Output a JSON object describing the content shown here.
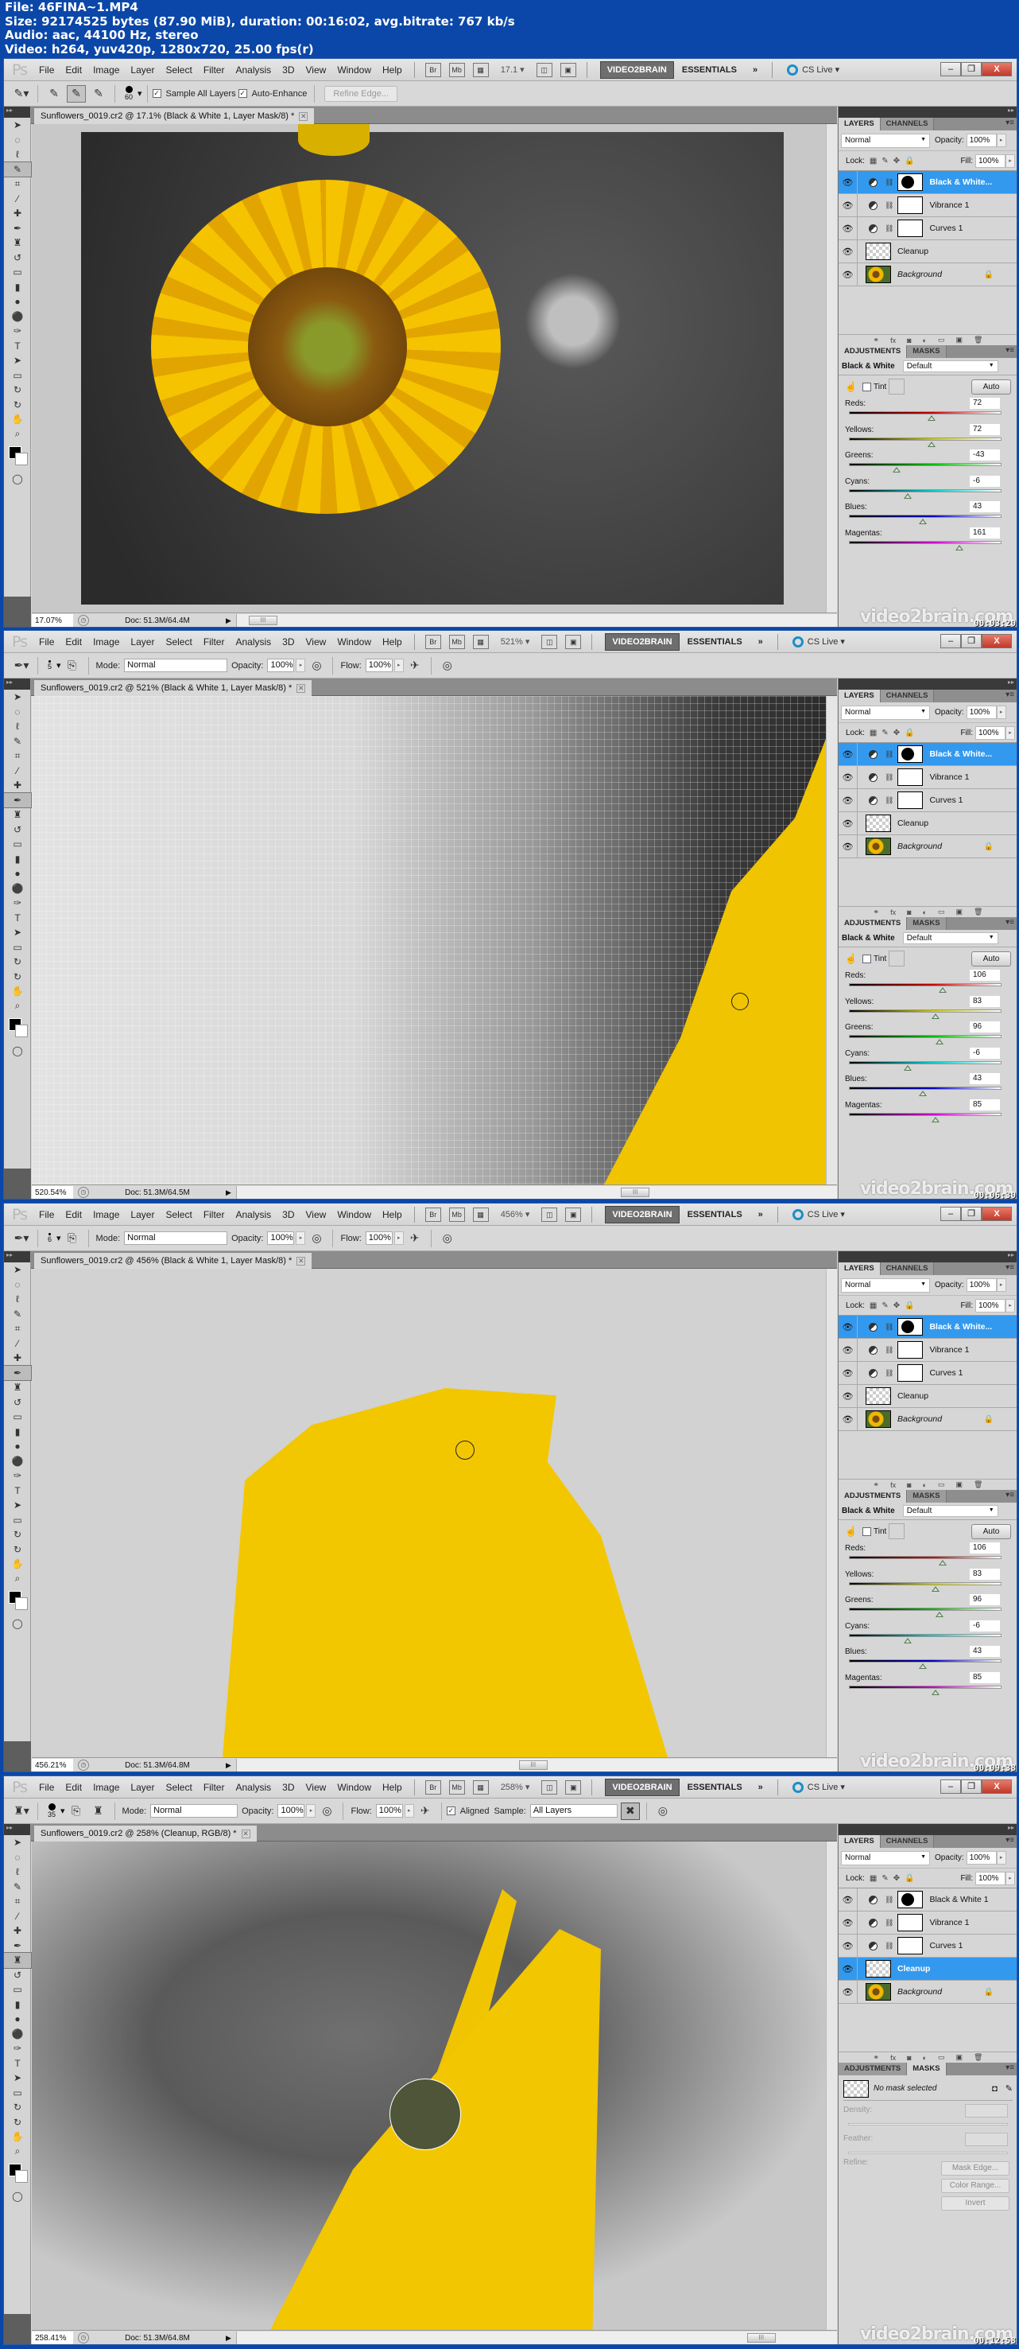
{
  "file_info": {
    "line1": "File: 46FINA~1.MP4",
    "line2": "Size: 92174525 bytes (87.90 MiB), duration: 00:16:02, avg.bitrate: 767 kb/s",
    "line3": "Audio: aac, 44100 Hz, stereo",
    "line4": "Video: h264, yuv420p, 1280x720, 25.00 fps(r)"
  },
  "app": {
    "logo": "Ps",
    "menus": [
      "File",
      "Edit",
      "Image",
      "Layer",
      "Select",
      "Filter",
      "Analysis",
      "3D",
      "View",
      "Window",
      "Help"
    ],
    "bridge_btn": "Br",
    "minibridge_btn": "Mb",
    "workspace_active": "VIDEO2BRAIN",
    "workspace_other": "ESSENTIALS",
    "more_workspaces": "»",
    "cs_live": "CS Live ▾",
    "win_minimize": "–",
    "win_restore": "❐",
    "win_close": "X"
  },
  "layers_panel": {
    "tab_layers": "LAYERS",
    "tab_channels": "CHANNELS",
    "blend_mode": "Normal",
    "opacity_label": "Opacity:",
    "opacity_value": "100%",
    "lock_label": "Lock:",
    "fill_label": "Fill:",
    "fill_value": "100%",
    "layers": [
      "Black & White 1",
      "Vibrance 1",
      "Curves 1",
      "Cleanup",
      "Background"
    ],
    "footer_icons": [
      "link-icon",
      "fx-icon",
      "mask-icon",
      "adjustment-icon",
      "folder-icon",
      "new-layer-icon",
      "trash-icon"
    ]
  },
  "adjustments_panel": {
    "tab_adjustments": "ADJUSTMENTS",
    "tab_masks": "MASKS",
    "title": "Black & White",
    "preset": "Default",
    "tint_label": "Tint",
    "auto_label": "Auto",
    "slider_labels": [
      "Reds:",
      "Yellows:",
      "Greens:",
      "Cyans:",
      "Blues:",
      "Magentas:"
    ],
    "slider_range": [
      -200,
      300
    ]
  },
  "watermark": "video2brain.com",
  "frames": [
    {
      "zoom_menu": "17.1",
      "doc_title": "Sunflowers_0019.cr2 @ 17.1% (Black & White 1, Layer Mask/8) *",
      "options": {
        "tool": "Quick Selection",
        "brush_size": "60",
        "sample_all_layers": "Sample All Layers",
        "auto_enhance": "Auto-Enhance",
        "refine_edge": "Refine Edge..."
      },
      "status_zoom": "17.07%",
      "status_doc": "Doc: 51.3M/64.4M",
      "selected_layer": "Black & White...",
      "values": [
        "72",
        "72",
        "-43",
        "-6",
        "43",
        "161"
      ],
      "timecode": "00:03:20"
    },
    {
      "zoom_menu": "521%",
      "doc_title": "Sunflowers_0019.cr2 @ 521% (Black & White 1, Layer Mask/8) *",
      "options": {
        "brush_size": "5",
        "mode_label": "Mode:",
        "mode": "Normal",
        "opacity_label": "Opacity:",
        "opacity": "100%",
        "flow_label": "Flow:",
        "flow": "100%"
      },
      "status_zoom": "520.54%",
      "status_doc": "Doc: 51.3M/64.5M",
      "selected_layer": "Black & White...",
      "values": [
        "106",
        "83",
        "96",
        "-6",
        "43",
        "85"
      ],
      "timecode": "00:06:30"
    },
    {
      "zoom_menu": "456%",
      "doc_title": "Sunflowers_0019.cr2 @ 456% (Black & White 1, Layer Mask/8) *",
      "options": {
        "brush_size": "6",
        "mode_label": "Mode:",
        "mode": "Normal",
        "opacity_label": "Opacity:",
        "opacity": "100%",
        "flow_label": "Flow:",
        "flow": "100%"
      },
      "status_zoom": "456.21%",
      "status_doc": "Doc: 51.3M/64.8M",
      "selected_layer": "Black & White...",
      "values": [
        "106",
        "83",
        "96",
        "-6",
        "43",
        "85"
      ],
      "timecode": "00:09:38"
    },
    {
      "zoom_menu": "258%",
      "doc_title": "Sunflowers_0019.cr2 @ 258% (Cleanup, RGB/8) *",
      "options": {
        "brush_size": "35",
        "mode_label": "Mode:",
        "mode": "Normal",
        "opacity_label": "Opacity:",
        "opacity": "100%",
        "flow_label": "Flow:",
        "flow": "100%",
        "aligned": "Aligned",
        "sample_label": "Sample:",
        "sample": "All Layers"
      },
      "status_zoom": "258.41%",
      "status_doc": "Doc: 51.3M/64.8M",
      "layer_names": [
        "Black & White 1",
        "Vibrance 1",
        "Curves 1",
        "Cleanup",
        "Background"
      ],
      "masks": {
        "no_mask": "No mask selected",
        "density": "Density:",
        "feather": "Feather:",
        "refine": "Refine:",
        "mask_edge": "Mask Edge...",
        "color_range": "Color Range...",
        "invert": "Invert"
      },
      "timecode": "00:12:58"
    }
  ]
}
